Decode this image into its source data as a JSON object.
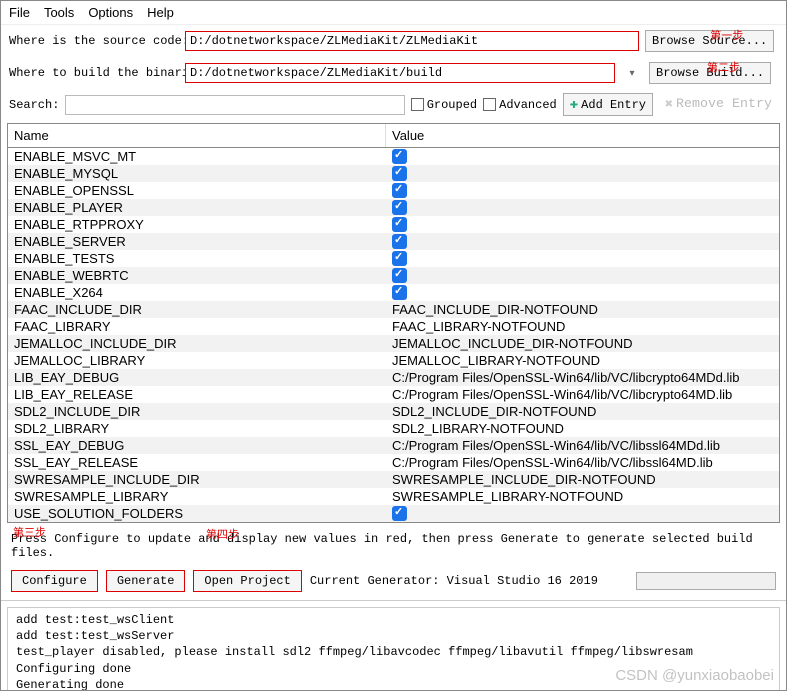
{
  "menu": {
    "file": "File",
    "tools": "Tools",
    "options": "Options",
    "help": "Help"
  },
  "labels": {
    "source": "Where is the source code:",
    "binaries": "Where to build the binaries:",
    "search": "Search:",
    "grouped": "Grouped",
    "advanced": "Advanced",
    "add_entry": "Add Entry",
    "remove_entry": "Remove Entry",
    "browse_source": "Browse Source...",
    "browse_build": "Browse Build..."
  },
  "paths": {
    "source": "D:/dotnetworkspace/ZLMediaKit/ZLMediaKit",
    "build": "D:/dotnetworkspace/ZLMediaKit/build"
  },
  "annotations": {
    "step1": "第一步",
    "step2": "第二步",
    "step3": "第三步",
    "step4": "第四步"
  },
  "grid": {
    "headers": {
      "name": "Name",
      "value": "Value"
    },
    "rows": [
      {
        "name": "ENABLE_MSVC_MT",
        "checked": true
      },
      {
        "name": "ENABLE_MYSQL",
        "checked": true
      },
      {
        "name": "ENABLE_OPENSSL",
        "checked": true
      },
      {
        "name": "ENABLE_PLAYER",
        "checked": true
      },
      {
        "name": "ENABLE_RTPPROXY",
        "checked": true
      },
      {
        "name": "ENABLE_SERVER",
        "checked": true
      },
      {
        "name": "ENABLE_TESTS",
        "checked": true
      },
      {
        "name": "ENABLE_WEBRTC",
        "checked": true
      },
      {
        "name": "ENABLE_X264",
        "checked": true
      },
      {
        "name": "FAAC_INCLUDE_DIR",
        "value": "FAAC_INCLUDE_DIR-NOTFOUND"
      },
      {
        "name": "FAAC_LIBRARY",
        "value": "FAAC_LIBRARY-NOTFOUND"
      },
      {
        "name": "JEMALLOC_INCLUDE_DIR",
        "value": "JEMALLOC_INCLUDE_DIR-NOTFOUND"
      },
      {
        "name": "JEMALLOC_LIBRARY",
        "value": "JEMALLOC_LIBRARY-NOTFOUND"
      },
      {
        "name": "LIB_EAY_DEBUG",
        "value": "C:/Program Files/OpenSSL-Win64/lib/VC/libcrypto64MDd.lib"
      },
      {
        "name": "LIB_EAY_RELEASE",
        "value": "C:/Program Files/OpenSSL-Win64/lib/VC/libcrypto64MD.lib"
      },
      {
        "name": "SDL2_INCLUDE_DIR",
        "value": "SDL2_INCLUDE_DIR-NOTFOUND"
      },
      {
        "name": "SDL2_LIBRARY",
        "value": "SDL2_LIBRARY-NOTFOUND"
      },
      {
        "name": "SSL_EAY_DEBUG",
        "value": "C:/Program Files/OpenSSL-Win64/lib/VC/libssl64MDd.lib"
      },
      {
        "name": "SSL_EAY_RELEASE",
        "value": "C:/Program Files/OpenSSL-Win64/lib/VC/libssl64MD.lib"
      },
      {
        "name": "SWRESAMPLE_INCLUDE_DIR",
        "value": "SWRESAMPLE_INCLUDE_DIR-NOTFOUND"
      },
      {
        "name": "SWRESAMPLE_LIBRARY",
        "value": "SWRESAMPLE_LIBRARY-NOTFOUND"
      },
      {
        "name": "USE_SOLUTION_FOLDERS",
        "checked": true
      }
    ]
  },
  "hint": "Press Configure to update and display new values in red,  then press Generate to generate selected build files.",
  "actions": {
    "configure": "Configure",
    "generate": "Generate",
    "open_project": "Open Project",
    "generator": "Current Generator: Visual Studio 16 2019"
  },
  "log_lines": [
    "add test:test_wsClient",
    "add test:test_wsServer",
    "test_player disabled, please install sdl2 ffmpeg/libavcodec ffmpeg/libavutil ffmpeg/libswresam",
    "Configuring done",
    "Generating done"
  ],
  "watermark": "CSDN @yunxiaobaobei"
}
